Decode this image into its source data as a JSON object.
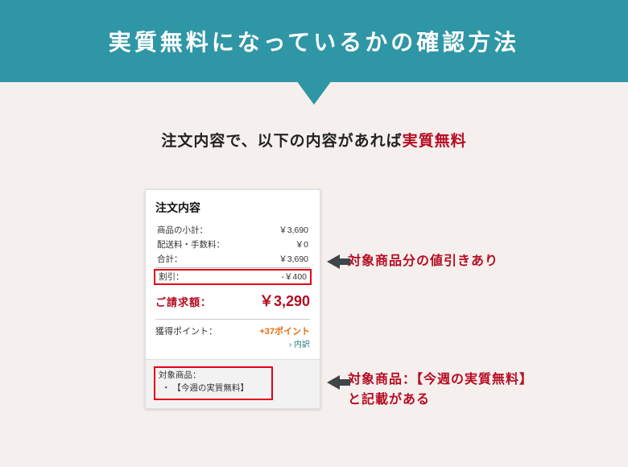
{
  "banner": {
    "title": "実質無料になっているかの確認方法"
  },
  "tagline": {
    "prefix": "注文内容で、以下の内容があれば",
    "emph": "実質無料"
  },
  "order": {
    "heading": "注文内容",
    "rows": {
      "subtotal": {
        "label": "商品の小計：",
        "value": "￥3,690"
      },
      "shipping": {
        "label": "配送料・手数料：",
        "value": "￥0"
      },
      "total": {
        "label": "合計：",
        "value": "￥3,690"
      },
      "discount": {
        "label": "割引：",
        "value": "-￥400"
      }
    },
    "bill": {
      "label": "ご請求額：",
      "value": "￥3,290"
    },
    "points": {
      "label": "獲得ポイント：",
      "value": "+37ポイント",
      "detail": "内訳"
    },
    "target": {
      "label": "対象商品：",
      "item": "【今週の実質無料】"
    }
  },
  "callouts": {
    "discount": "対象商品分の値引きあり",
    "target_line1": "対象商品：【今週の実質無料】",
    "target_line2": "と記載がある"
  }
}
